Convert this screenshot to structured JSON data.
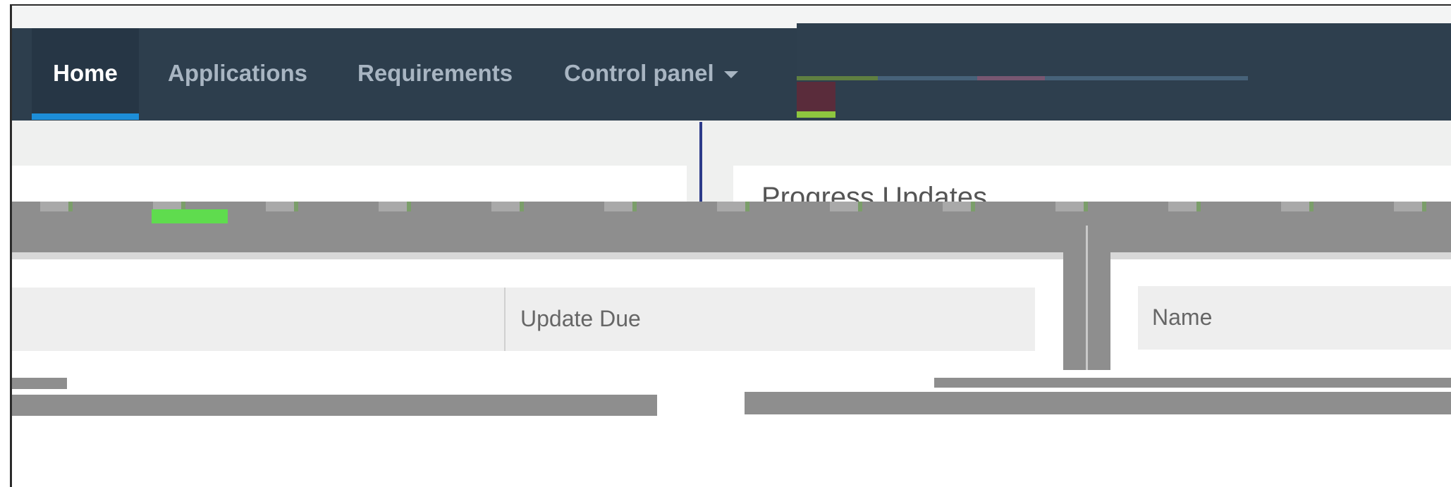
{
  "nav": {
    "items": [
      {
        "label": "Home",
        "active": true
      },
      {
        "label": "Applications",
        "active": false
      },
      {
        "label": "Requirements",
        "active": false
      },
      {
        "label": "Control panel",
        "active": false,
        "has_dropdown": true
      }
    ]
  },
  "panel_right": {
    "title": "Progress Updates"
  },
  "table_left": {
    "columns": [
      "",
      "Update Due"
    ]
  },
  "table_right": {
    "columns": [
      "Name"
    ]
  },
  "colors": {
    "navbar": "#2d3e4d",
    "nav_active_bg": "#263645",
    "nav_active_underline": "#1d8ed8",
    "nav_text": "#a8b5c2",
    "table_header_bg": "#eeeeee"
  }
}
